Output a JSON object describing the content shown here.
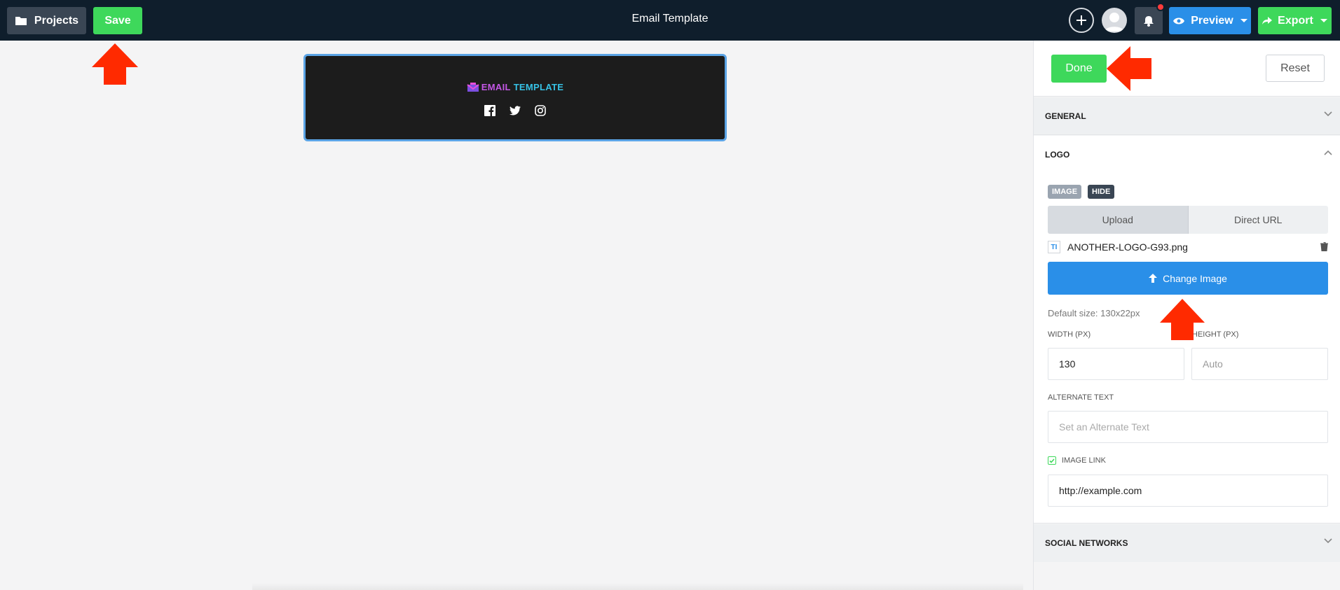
{
  "topbar": {
    "projects_label": "Projects",
    "save_label": "Save",
    "title": "Email Template",
    "preview_label": "Preview",
    "export_label": "Export"
  },
  "canvas": {
    "email_logo_first": "E",
    "email_logo_mid": "MAIL",
    "email_logo_last": "TEMPLATE",
    "social_icons": [
      "facebook-icon",
      "twitter-icon",
      "instagram-icon"
    ]
  },
  "panel": {
    "done_label": "Done",
    "reset_label": "Reset",
    "sections": {
      "general": "General",
      "logo": "Logo",
      "social": "Social Networks"
    },
    "logo": {
      "tag_image": "Image",
      "tag_hide": "Hide",
      "tab_upload": "Upload",
      "tab_direct_url": "Direct URL",
      "file_thumb": "TI",
      "file_name": "ANOTHER-LOGO-G93.png",
      "change_image_label": "Change Image",
      "default_size": "Default size: 130x22px",
      "width_label": "Width (px)",
      "width_value": "130",
      "height_label": "Height (px)",
      "height_placeholder": "Auto",
      "alt_label": "Alternate Text",
      "alt_placeholder": "Set an Alternate Text",
      "image_link_label": "Image Link",
      "image_link_checked": true,
      "image_link_value": "http://example.com"
    }
  },
  "colors": {
    "topbar": "#0f1e2c",
    "green": "#3ed85b",
    "blue": "#2a8fe8",
    "annotation": "#ff2a00"
  }
}
